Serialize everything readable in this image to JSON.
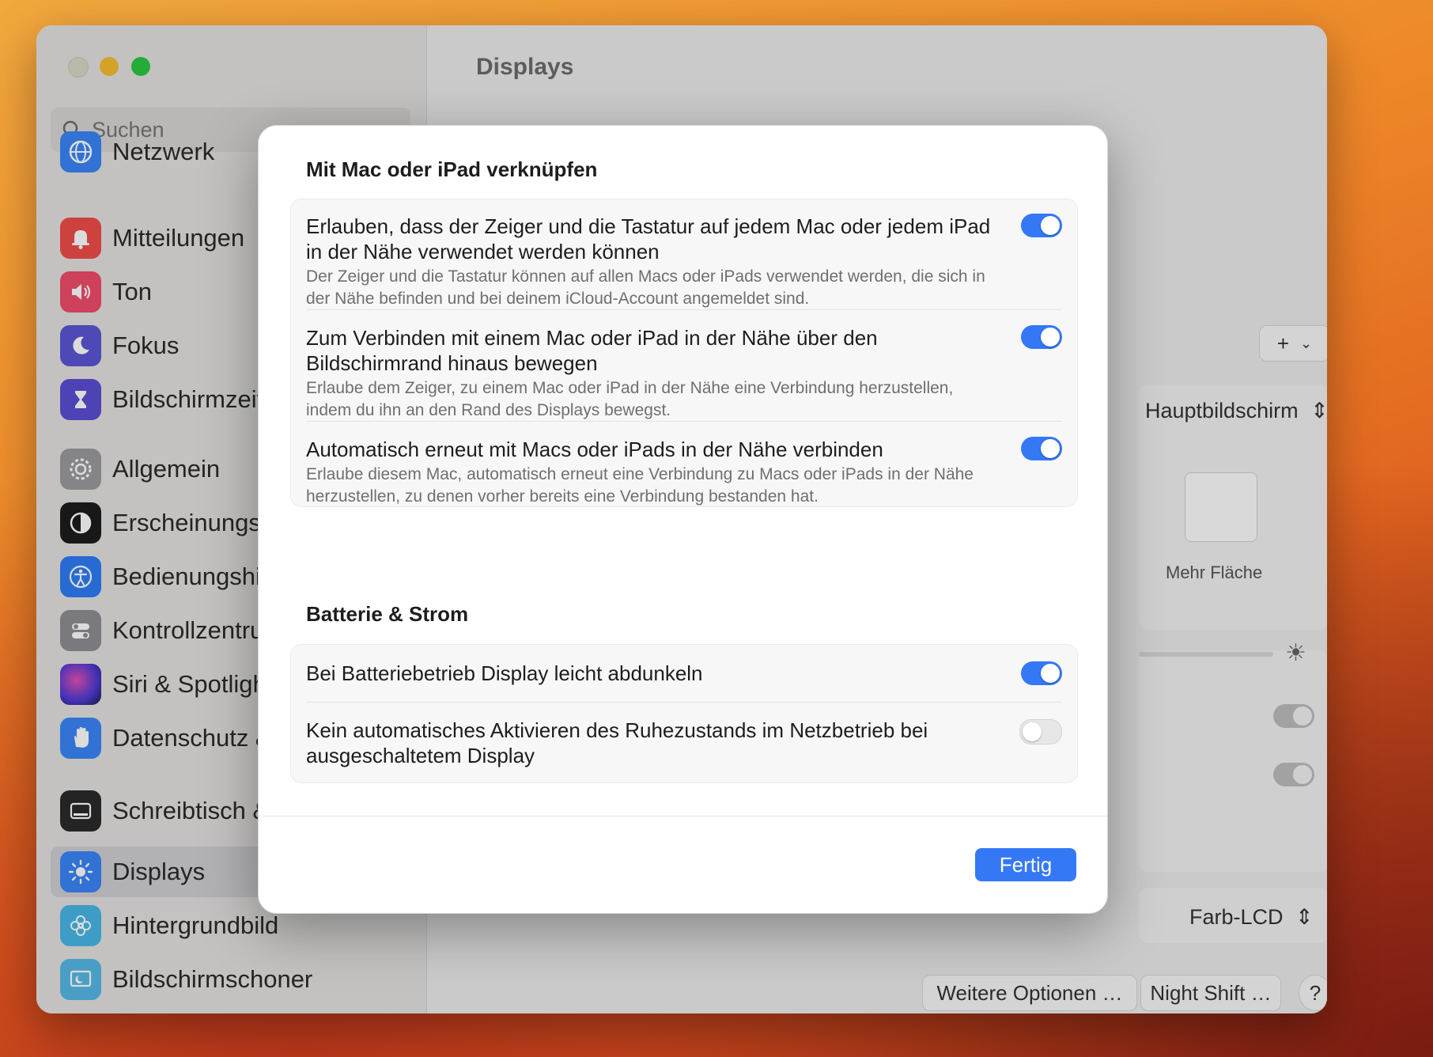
{
  "colors": {
    "accent": "#3478f6",
    "window_bg": "#ececec"
  },
  "sidebar": {
    "search_placeholder": "Suchen",
    "items": [
      {
        "label": "Netzwerk",
        "icon": "globe-icon",
        "color": "#3a85f7"
      },
      {
        "label": "Mitteilungen",
        "icon": "bell-icon",
        "color": "#ef4c49"
      },
      {
        "label": "Ton",
        "icon": "speaker-icon",
        "color": "#ef4c6b"
      },
      {
        "label": "Fokus",
        "icon": "moon-icon",
        "color": "#5a55d6"
      },
      {
        "label": "Bildschirmzeit",
        "icon": "hourglass-icon",
        "color": "#5a4fd2"
      },
      {
        "label": "Allgemein",
        "icon": "gear-icon",
        "color": "#9b9b9f"
      },
      {
        "label": "Erscheinungsbild",
        "icon": "appearance-icon",
        "color": "#1c1c1e"
      },
      {
        "label": "Bedienungshilfen",
        "icon": "accessibility-icon",
        "color": "#2f7cf6"
      },
      {
        "label": "Kontrollzentrum",
        "icon": "toggles-icon",
        "color": "#8e8e93"
      },
      {
        "label": "Siri & Spotlight",
        "icon": "siri-icon",
        "color": "#3a2e6e"
      },
      {
        "label": "Datenschutz & Sicherheit",
        "icon": "hand-icon",
        "color": "#3a85f7"
      },
      {
        "label": "Schreibtisch & Dock",
        "icon": "dock-icon",
        "color": "#2a2a2a"
      },
      {
        "label": "Displays",
        "icon": "sun-icon",
        "color": "#3a85f7"
      },
      {
        "label": "Hintergrundbild",
        "icon": "flower-icon",
        "color": "#49b7e8"
      },
      {
        "label": "Bildschirmschoner",
        "icon": "screensaver-icon",
        "color": "#57b8e6"
      }
    ]
  },
  "main": {
    "title": "Displays",
    "main_display_select": "Hauptbildschirm",
    "preview_label": "Mehr Fläche",
    "color_profile": "Farb-LCD",
    "buttons": {
      "more_options": "Weitere Optionen …",
      "night_shift": "Night Shift …",
      "help": "?"
    },
    "add_button": "+"
  },
  "dialog": {
    "section1_title": "Mit Mac oder iPad verknüpfen",
    "section1_rows": [
      {
        "title": "Erlauben, dass der Zeiger und die Tastatur auf jedem Mac oder jedem iPad in der Nähe verwendet werden können",
        "desc": "Der Zeiger und die Tastatur können auf allen Macs oder iPads verwendet werden, die sich in der Nähe befinden und bei deinem iCloud-Account angemeldet sind.",
        "on": true
      },
      {
        "title": "Zum Verbinden mit einem Mac oder iPad in der Nähe über den Bildschirmrand hinaus bewegen",
        "desc": "Erlaube dem Zeiger, zu einem Mac oder iPad in der Nähe eine Verbindung herzustellen, indem du ihn an den Rand des Displays bewegst.",
        "on": true
      },
      {
        "title": "Automatisch erneut mit Macs oder iPads in der Nähe verbinden",
        "desc": "Erlaube diesem Mac, automatisch erneut eine Verbindung zu Macs oder iPads in der Nähe herzustellen, zu denen vorher bereits eine Verbindung bestanden hat.",
        "on": true
      }
    ],
    "section2_title": "Batterie & Strom",
    "section2_rows": [
      {
        "title": "Bei Batteriebetrieb Display leicht abdunkeln",
        "on": true
      },
      {
        "title": "Kein automatisches Aktivieren des Ruhezustands im Netzbetrieb bei ausgeschaltetem Display",
        "on": false
      }
    ],
    "done_button": "Fertig"
  }
}
